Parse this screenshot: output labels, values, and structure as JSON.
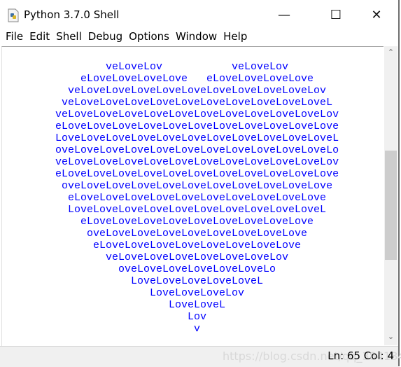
{
  "window": {
    "title": "Python 3.7.0 Shell",
    "minimize": "—",
    "maximize": "☐",
    "close": "✕"
  },
  "menu": [
    "File",
    "Edit",
    "Shell",
    "Debug",
    "Options",
    "Window",
    "Help"
  ],
  "output_color": "#0000ff",
  "output_lines": [
    "        veLoveLov           veLoveLov",
    "    eLoveLoveLoveLove   eLoveLoveLoveLove",
    "  veLoveLoveLoveLoveLoveLoveLoveLoveLoveLov",
    " veLoveLoveLoveLoveLoveLoveLoveLoveLoveLoveL",
    "veLoveLoveLoveLoveLoveLoveLoveLoveLoveLoveLov",
    "eLoveLoveLoveLoveLoveLoveLoveLoveLoveLoveLove",
    "LoveLoveLoveLoveLoveLoveLoveLoveLoveLoveLoveL",
    "oveLoveLoveLoveLoveLoveLoveLoveLoveLoveLoveLo",
    "veLoveLoveLoveLoveLoveLoveLoveLoveLoveLoveLov",
    "eLoveLoveLoveLoveLoveLoveLoveLoveLoveLoveLove",
    " oveLoveLoveLoveLoveLoveLoveLoveLoveLoveLove",
    "  eLoveLoveLoveLoveLoveLoveLoveLoveLoveLove",
    "  LoveLoveLoveLoveLoveLoveLoveLoveLoveLoveL",
    "    eLoveLoveLoveLoveLoveLoveLoveLoveLove",
    "     oveLoveLoveLoveLoveLoveLoveLoveLove",
    "      eLoveLoveLoveLoveLoveLoveLoveLove",
    "        veLoveLoveLoveLoveLoveLoveLov",
    "          oveLoveLoveLoveLoveLoveLo",
    "            LoveLoveLoveLoveLoveL",
    "               LoveLoveLoveLov",
    "                  LoveLoveL",
    "                     Lov",
    "                      v"
  ],
  "status": {
    "position": "Ln: 65   Col: 4",
    "watermark": "https://blog.csdn.net/qq_38418409"
  }
}
